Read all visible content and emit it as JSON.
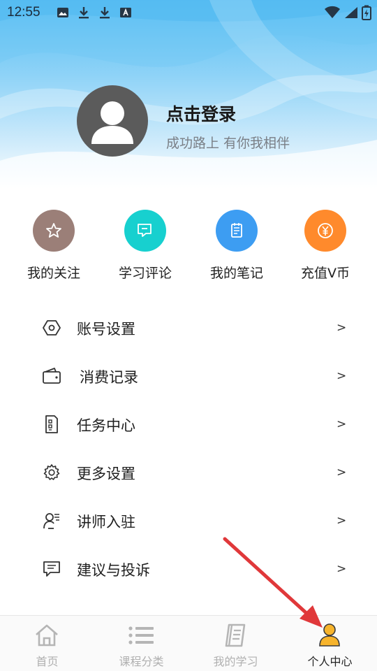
{
  "status_bar": {
    "time": "12:55",
    "left_icons": [
      "image-icon",
      "download-icon",
      "download-icon",
      "font-icon"
    ],
    "right_icons": [
      "wifi-icon",
      "signal-icon",
      "battery-charging-icon"
    ]
  },
  "profile": {
    "title": "点击登录",
    "subtitle": "成功路上 有你我相伴",
    "avatar_icon": "user-avatar-icon"
  },
  "quick_actions": [
    {
      "label": "我的关注",
      "icon": "star-icon",
      "color": "#9b7f78"
    },
    {
      "label": "学习评论",
      "icon": "comment-icon",
      "color": "#17d0cf"
    },
    {
      "label": "我的笔记",
      "icon": "note-icon",
      "color": "#3d9df2"
    },
    {
      "label": "充值V币",
      "icon": "yen-icon",
      "color": "#ff8a2c"
    }
  ],
  "menu": [
    {
      "label": "账号设置",
      "icon": "hexagon-nut-icon",
      "chevron": ">"
    },
    {
      "label": "消费记录",
      "icon": "wallet-icon",
      "chevron": ">"
    },
    {
      "label": "任务中心",
      "icon": "task-document-icon",
      "chevron": ">"
    },
    {
      "label": "更多设置",
      "icon": "gear-icon",
      "chevron": ">"
    },
    {
      "label": "讲师入驻",
      "icon": "teacher-icon",
      "chevron": ">"
    },
    {
      "label": "建议与投诉",
      "icon": "feedback-icon",
      "chevron": ">"
    }
  ],
  "bottom_nav": [
    {
      "label": "首页",
      "icon": "home-icon",
      "active": false
    },
    {
      "label": "课程分类",
      "icon": "list-icon",
      "active": false
    },
    {
      "label": "我的学习",
      "icon": "notebook-icon",
      "active": false
    },
    {
      "label": "个人中心",
      "icon": "person-icon",
      "active": true
    }
  ],
  "colors": {
    "header_blue": "#55bdf3",
    "active_nav": "#f7b42c",
    "inactive_nav": "#b0b0b0",
    "annotation_arrow": "#e0383a"
  }
}
